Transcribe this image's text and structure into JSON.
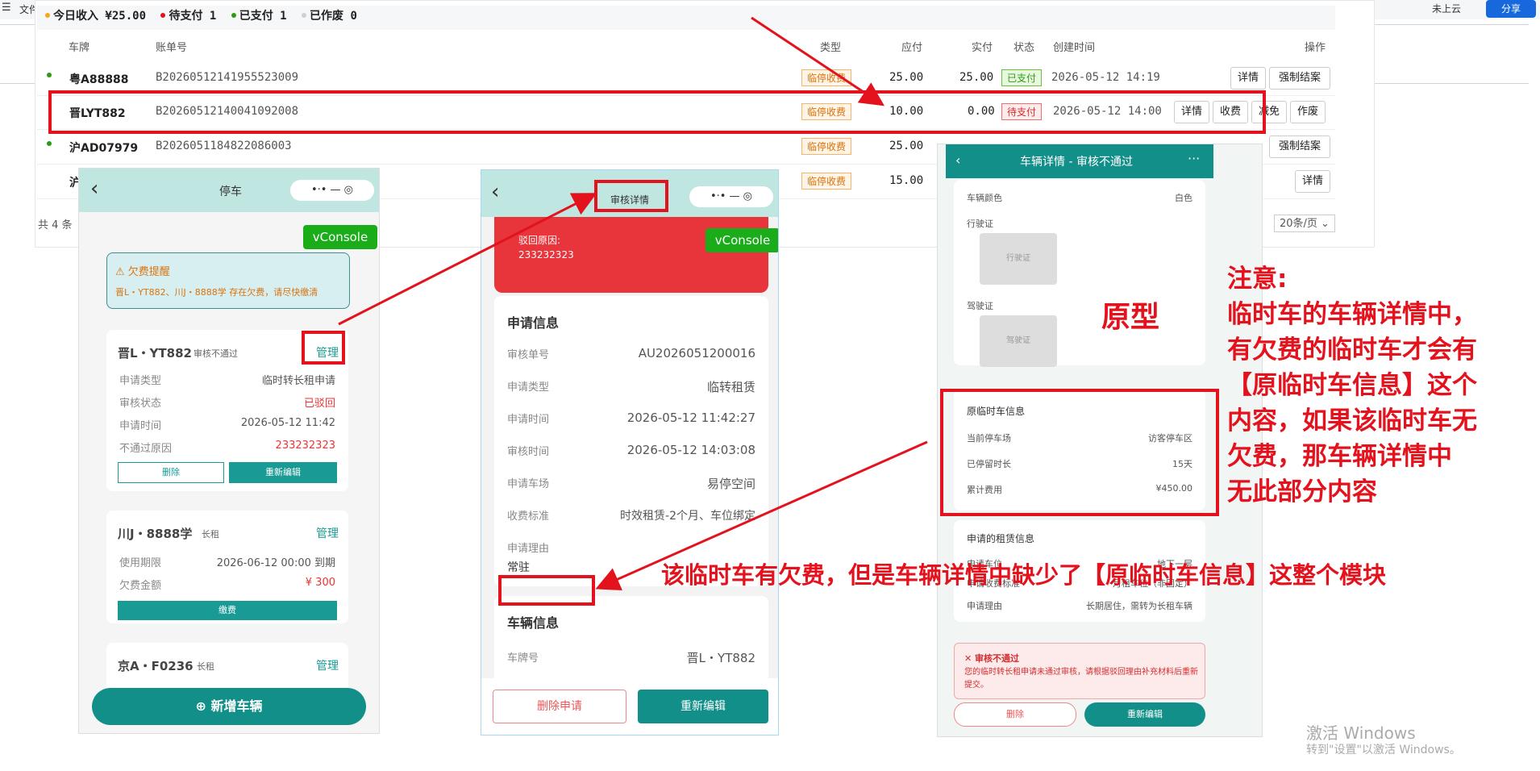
{
  "topbar": {
    "menu_icon": "☰",
    "menu_label": "文件",
    "cloud_label": "未上云",
    "share_label": "分享"
  },
  "summary": {
    "items": [
      {
        "color": "#f5a623",
        "text": "今日收入 ¥25.00"
      },
      {
        "color": "#e3121d",
        "text": "待支付 1"
      },
      {
        "color": "#2e9a14",
        "text": "已支付 1"
      },
      {
        "color": "#cfcfcf",
        "text": "已作废 0"
      }
    ]
  },
  "table": {
    "headers": {
      "plate": "车牌",
      "bill_no": "账单号",
      "type": "类型",
      "due": "应付",
      "paid": "实付",
      "status": "状态",
      "created": "创建时间",
      "ops": "操作"
    },
    "rows": [
      {
        "plate": "粤A88888",
        "bill_no": "B20260512141955523009",
        "type": "临停收费",
        "due": "25.00",
        "paid": "25.00",
        "status": "已支付",
        "created": "2026-05-12 14:19",
        "actions": [
          "详情",
          "强制结案"
        ]
      },
      {
        "plate": "晋LYT882",
        "bill_no": "B20260512140041092008",
        "type": "临停收费",
        "due": "10.00",
        "paid": "0.00",
        "status": "待支付",
        "created": "2026-05-12 14:00",
        "actions": [
          "详情",
          "收费",
          "减免",
          "作废"
        ]
      },
      {
        "plate": "沪AD07979",
        "bill_no": "B2026051184822086003",
        "type": "临停收费",
        "due": "25.00",
        "paid": "",
        "status": "",
        "created": "",
        "actions": [
          "强制结案"
        ]
      },
      {
        "plate": "沪",
        "bill_no": "",
        "type": "临停收费",
        "due": "15.00",
        "paid": "",
        "status": "",
        "created": "",
        "actions": [
          "详情"
        ]
      }
    ],
    "footer_total": "共 4 条",
    "page_size": "20条/页 ⌄"
  },
  "phone1": {
    "title": "停车",
    "back": "‹",
    "capsule": "•·•  —  ◎",
    "vconsole": "vConsole",
    "alert": {
      "title": "⚠ 欠费提醒",
      "text": "晋L・YT882、川J・8888学 存在欠费，请尽快缴清"
    },
    "cards": [
      {
        "plate": "晋L・YT882",
        "tag": "审核不通过",
        "manage": "管理",
        "rows": [
          [
            "申请类型",
            "临时转长租申请"
          ],
          [
            "审核状态",
            "已驳回"
          ],
          [
            "申请时间",
            "2026-05-12 11:42"
          ],
          [
            "不通过原因",
            "233232323"
          ]
        ],
        "btn_delete": "删除",
        "btn_edit": "重新编辑"
      },
      {
        "plate": "川J・8888学",
        "tag": "长租",
        "manage": "管理",
        "rows": [
          [
            "使用期限",
            "2026-06-12 00:00 到期"
          ],
          [
            "欠费金额",
            "¥ 300"
          ]
        ],
        "btn_pay": "缴费"
      },
      {
        "plate": "京A・F0236",
        "tag": "长租",
        "manage": "管理"
      }
    ],
    "add_button": "⊕ 新增车辆"
  },
  "phone2": {
    "title": "审核详情",
    "back": "‹",
    "capsule": "•·•  —  ◎",
    "vconsole": "vConsole",
    "reject": {
      "label": "驳回原因:",
      "value": "233232323"
    },
    "apply_section": "申请信息",
    "apply_rows": [
      [
        "审核单号",
        "AU2026051200016"
      ],
      [
        "申请类型",
        "临转租赁"
      ],
      [
        "申请时间",
        "2026-05-12 11:42:27"
      ],
      [
        "审核时间",
        "2026-05-12 14:03:08"
      ],
      [
        "申请车场",
        "易停空间"
      ],
      [
        "收费标准",
        "时效租赁-2个月、车位绑定"
      ]
    ],
    "reason_label": "申请理由",
    "reason_value": "常驻",
    "vehicle_section": "车辆信息",
    "plate_label": "车牌号",
    "plate_value": "晋L・YT882",
    "btn_delete": "删除申请",
    "btn_edit": "重新编辑"
  },
  "phone3": {
    "title": "车辆详情 - 审核不通过",
    "back": "‹",
    "more": "···",
    "color_label": "车辆颜色",
    "color_value": "白色",
    "license_label": "行驶证",
    "license_placeholder": "行驶证",
    "driver_label": "驾驶证",
    "driver_placeholder": "驾驶证",
    "orig_section": "原临时车信息",
    "orig_rows": [
      [
        "当前停车场",
        "访客停车区"
      ],
      [
        "已停留时长",
        "15天"
      ],
      [
        "累计费用",
        "¥450.00"
      ]
    ],
    "lease_section": "申请的租赁信息",
    "lease_rows": [
      [
        "申请车位",
        "地下一层"
      ],
      [
        "申请收费标准",
        "月租车位（非固定）"
      ],
      [
        "申请理由",
        "长期居住，需转为长租车辆"
      ]
    ],
    "fail_title": "✕ 审核不通过",
    "fail_text": "您的临时转长租申请未通过审核，请根据驳回理由补充材料后重新提交。",
    "btn_delete": "删除",
    "btn_edit": "重新编辑"
  },
  "annotations": {
    "prototype": "原型",
    "note": [
      "注意:",
      "临时车的车辆详情中，",
      "有欠费的临时车才会有",
      "【原临时车信息】这个",
      "内容，如果该临时车无",
      "欠费，那车辆详情中",
      "无此部分内容"
    ],
    "issue": "该临时车有欠费，但是车辆详情中缺少了【原临时车信息】这整个模块"
  },
  "watermark": {
    "line1": "激活 Windows",
    "line2": "转到\"设置\"以激活 Windows。"
  }
}
